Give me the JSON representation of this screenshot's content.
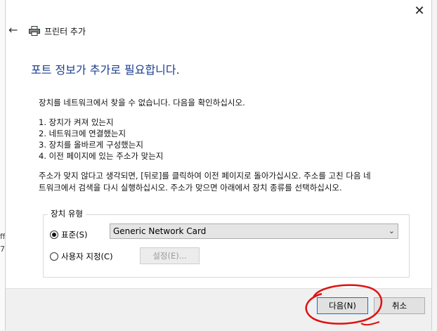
{
  "window": {
    "title": "프린터 추가",
    "close_glyph": "✕",
    "back_glyph": "←"
  },
  "page": {
    "heading": "포트 정보가 추가로 필요합니다.",
    "intro": "장치를 네트워크에서 찾을 수 없습니다. 다음을 확인하십시오.",
    "checks": [
      "1.  장치가 켜져 있는지",
      "2.  네트워크에 연결했는지",
      "3.  장치를 올바르게 구성했는지",
      "4.  이전 페이지에 있는 주소가 맞는지"
    ],
    "advice_line1": "주소가 맞지 않다고 생각되면, [뒤로]를 클릭하여 이전 페이지로 돌아가십시오. 주소를 고친 다음 네",
    "advice_line2": "트워크에서 검색을 다시 실행하십시오. 주소가 맞으면 아래에서 장치 종류를 선택하십시오."
  },
  "device_type": {
    "group_label": "장치 유형",
    "standard_label": "표준(S)",
    "standard_selected": true,
    "standard_value": "Generic Network Card",
    "custom_label": "사용자 지정(C)",
    "custom_selected": false,
    "settings_button": "설정(E)..."
  },
  "footer": {
    "next_label": "다음(N)",
    "cancel_label": "취소"
  },
  "background": {
    "left_fragments": [
      "ff",
      "7"
    ]
  },
  "colors": {
    "heading": "#1a3d8f",
    "annotation": "#e01010",
    "focus_border": "#0078d7"
  },
  "icons": {
    "printer": "printer-icon",
    "back": "back-arrow-icon",
    "close": "close-icon",
    "dropdown": "chevron-down-icon"
  }
}
